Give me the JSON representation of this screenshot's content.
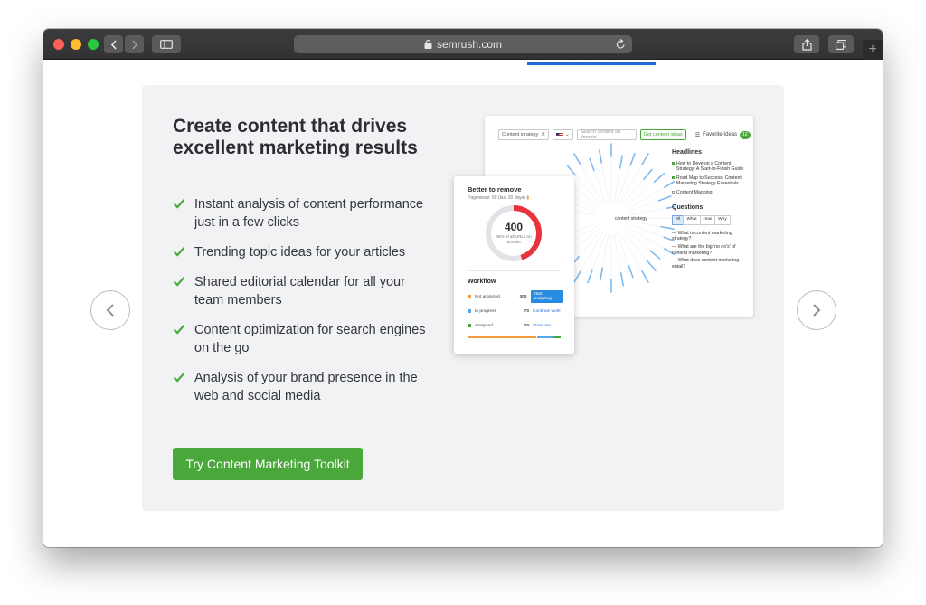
{
  "browser": {
    "url": "semrush.com"
  },
  "promo": {
    "headline": "Create content that drives excellent marketing results",
    "features": [
      "Instant analysis of content performance just in a few clicks",
      "Trending topic ideas for your articles",
      "Shared editorial calendar for all your team members",
      "Content optimization for search engines on the go",
      "Analysis of your brand presence in the web and social media"
    ],
    "cta_label": "Try Content Marketing Toolkit"
  },
  "topic_tool": {
    "topic_chip": "Content strategy",
    "search_placeholder": "Search content on domain",
    "get_ideas_label": "Get content ideas",
    "favorite_label": "Favorite Ideas",
    "favorite_count": "12",
    "center_label": "content strategy",
    "headlines_title": "Headlines",
    "headlines": [
      "How to Develop a Content Strategy: A Start-to-Finish Guide",
      "Road Map to Success: Content Marketing Strategy Essentials",
      "Content Mapping"
    ],
    "questions_title": "Questions",
    "question_tabs": [
      "All",
      "What",
      "How",
      "Why"
    ],
    "questions": [
      "— What is content marketing strategy?",
      "— What are the big 'no no's' of content marketing?",
      "— What does content marketing entail?"
    ]
  },
  "audit_card": {
    "title": "Better to remove",
    "subtitle": "Pageviews: 69 (last 30 days)",
    "value": "400",
    "value_fraction": 0.45,
    "note": "45% of all URLs on domain",
    "workflow_title": "Workflow",
    "rows": [
      {
        "label": "Not analyzed",
        "count": "300",
        "action": "Start analyzing",
        "color": "#f39a3b"
      },
      {
        "label": "In progress",
        "count": "70",
        "action": "Continue work",
        "color": "#5aa6e8"
      },
      {
        "label": "Analyzed",
        "count": "30",
        "action": "Show me",
        "color": "#4aa83a"
      }
    ]
  },
  "colors": {
    "accent_green": "#4aa83a",
    "tab_indicator": "#1e6dd6",
    "donut_red": "#e8333c"
  }
}
